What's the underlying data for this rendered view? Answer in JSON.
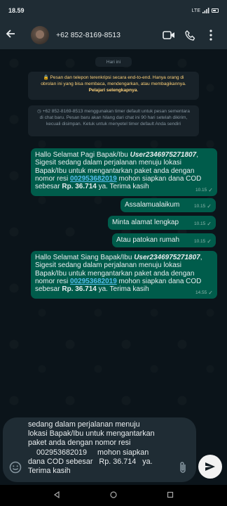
{
  "status_bar": {
    "time": "18.59",
    "network": "LTE"
  },
  "header": {
    "title": "+62 852-8169-8513"
  },
  "chat": {
    "date_chip": "Hari ini",
    "encryption_notice": "Pesan dan telepon terenkripsi secara end-to-end. Hanya orang di obrolan ini yang bisa membaca, mendengarkan, atau membagikannya.",
    "encryption_link": "Pelajari selengkapnya",
    "timer_notice": "+62 852-8169-8513 menggunakan timer default untuk pesan sementara di chat baru. Pesan baru akan hilang dari chat ini 90 hari setelah dikirim, kecuali disimpan. Ketuk untuk menyetel timer default Anda sendiri",
    "messages": [
      {
        "pre": "Hallo Selamat Pagi Bapak/Ibu ",
        "user": "User2346975271807",
        "mid": ", Sigesit sedang dalam perjalanan menuju lokasi Bapak/Ibu untuk mengantarkan paket anda dengan nomor resi ",
        "resi": "002953682019",
        "post1": " mohon siapkan dana COD sebesar ",
        "amount": "Rp. 36.714",
        "post2": " ya. Terima kasih",
        "time": "10.15"
      },
      {
        "text": "Assalamualaikum",
        "time": "10.15"
      },
      {
        "text": "Minta alamat lengkap",
        "time": "10.15"
      },
      {
        "text": "Atau patokan rumah",
        "time": "10.15"
      },
      {
        "pre": "Hallo Selamat Siang Bapak/Ibu ",
        "user": "User2346975271807",
        "mid": ", Sigesit sedang dalam perjalanan menuju lokasi Bapak/Ibu untuk mengantarkan paket anda dengan nomor resi ",
        "resi": "002953682019",
        "post1": " mohon siapkan dana COD sebesar ",
        "amount": "Rp. 36.714",
        "post2": " ya. Terima kasih",
        "time": "14.55"
      }
    ]
  },
  "composer": {
    "text": "sedang dalam perjalanan menuju\nlokasi Bapak/Ibu untuk mengantarkan\npaket anda dengan nomor resi\n    002953682019     mohon siapkan\ndana COD sebesar   Rp. 36.714   ya.\nTerima kasih"
  },
  "colors": {
    "background": "#0b141a",
    "header": "#1f2c34",
    "outgoing_bubble": "#005c4b",
    "notice_text": "#ffd279",
    "link": "#53bdeb"
  }
}
